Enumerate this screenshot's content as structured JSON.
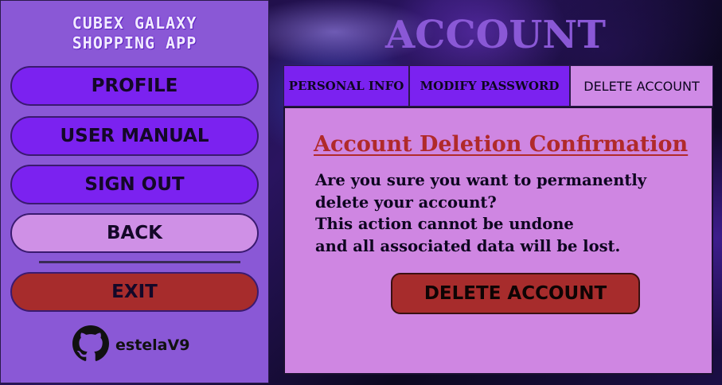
{
  "app": {
    "title_line1": "CUBEX GALAXY",
    "title_line2": "SHOPPING APP"
  },
  "sidebar": {
    "buttons": [
      {
        "label": "PROFILE"
      },
      {
        "label": "USER MANUAL"
      },
      {
        "label": "SIGN OUT"
      },
      {
        "label": "BACK"
      },
      {
        "label": "EXIT"
      }
    ],
    "github": {
      "icon": "github-icon",
      "username": "estelaV9"
    }
  },
  "header": {
    "title": "ACCOUNT"
  },
  "tabs": [
    {
      "label": "PERSONAL INFO",
      "selected": false
    },
    {
      "label": "MODIFY PASSWORD",
      "selected": false
    },
    {
      "label": "DELETE ACCOUNT",
      "selected": true
    }
  ],
  "delete_panel": {
    "heading": "Account Deletion Confirmation",
    "message_lines": [
      "Are you sure you want to permanently",
      "delete your account?",
      "This action cannot be undone",
      "and all associated data will be lost."
    ],
    "button_label": "DELETE ACCOUNT"
  },
  "colors": {
    "sidebar_bg": "#8a58d6",
    "primary_button": "#7b22f0",
    "secondary_button": "#cf90e6",
    "danger": "#a72c2c",
    "panel_bg": "#cf86e2",
    "heading_red": "#b02a2a"
  }
}
